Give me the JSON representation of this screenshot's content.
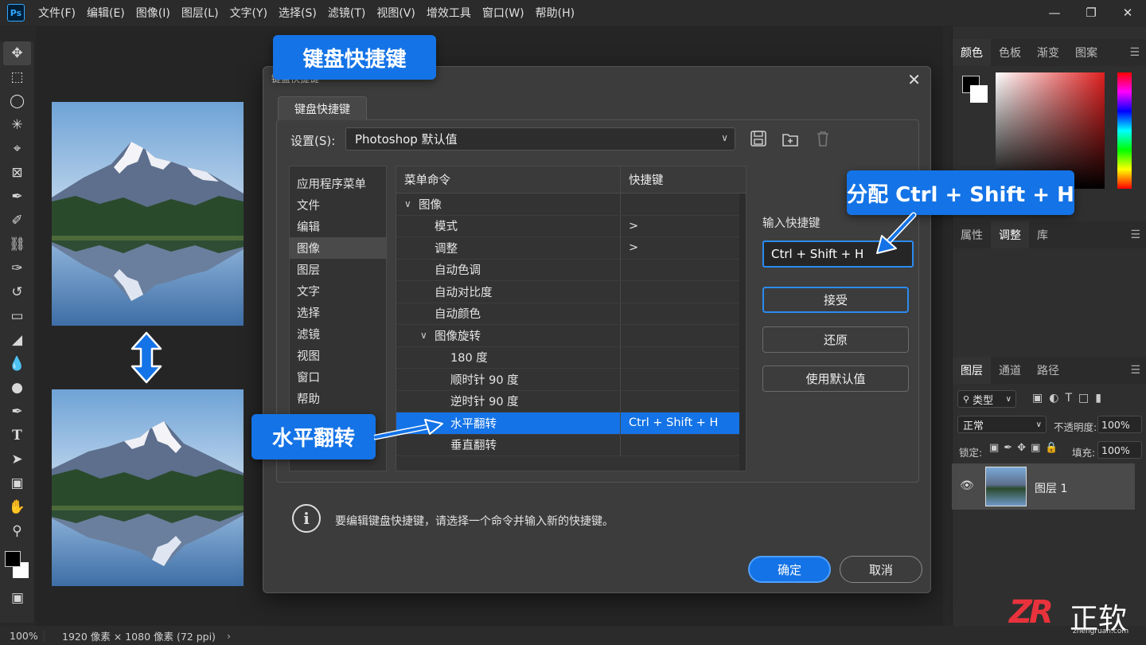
{
  "app": {
    "logo": "Ps"
  },
  "menu": [
    "文件(F)",
    "编辑(E)",
    "图像(I)",
    "图层(L)",
    "文字(Y)",
    "选择(S)",
    "滤镜(T)",
    "视图(V)",
    "增效工具",
    "窗口(W)",
    "帮助(H)"
  ],
  "status": {
    "zoom": "100%",
    "doc_info": "1920 像素 × 1080 像素 (72 ppi)"
  },
  "callouts": {
    "top": "键盘快捷键",
    "left": "水平翻转",
    "right": "分配 Ctrl + Shift + H"
  },
  "dialog": {
    "title": "键盘快捷键",
    "tab": "键盘快捷键",
    "set_label": "设置(S):",
    "set_value": "Photoshop 默认值",
    "categories": [
      "应用程序菜单",
      "文件",
      "编辑",
      "图像",
      "图层",
      "文字",
      "选择",
      "滤镜",
      "视图",
      "窗口",
      "帮助"
    ],
    "selected_category": "图像",
    "table": {
      "col_command": "菜单命令",
      "col_shortcut": "快捷键",
      "rows": [
        {
          "indent": 0,
          "twisty": "∨",
          "label": "图像",
          "shortcut": ""
        },
        {
          "indent": 1,
          "twisty": "",
          "label": "模式",
          "shortcut": ">"
        },
        {
          "indent": 1,
          "twisty": "",
          "label": "调整",
          "shortcut": ">"
        },
        {
          "indent": 1,
          "twisty": "",
          "label": "自动色调",
          "shortcut": ""
        },
        {
          "indent": 1,
          "twisty": "",
          "label": "自动对比度",
          "shortcut": ""
        },
        {
          "indent": 1,
          "twisty": "",
          "label": "自动颜色",
          "shortcut": ""
        },
        {
          "indent": 1,
          "twisty": "∨",
          "label": "图像旋转",
          "shortcut": ""
        },
        {
          "indent": 2,
          "twisty": "",
          "label": "180 度",
          "shortcut": ""
        },
        {
          "indent": 2,
          "twisty": "",
          "label": "顺时针 90 度",
          "shortcut": ""
        },
        {
          "indent": 2,
          "twisty": "",
          "label": "逆时针 90 度",
          "shortcut": ""
        },
        {
          "indent": 2,
          "twisty": "",
          "label": "水平翻转",
          "shortcut": "Ctrl + Shift + H",
          "selected": true
        },
        {
          "indent": 2,
          "twisty": "",
          "label": "垂直翻转",
          "shortcut": ""
        }
      ]
    },
    "input_label": "输入快捷键",
    "input_value": "Ctrl + Shift + H",
    "btn_accept": "接受",
    "btn_undo": "还原",
    "btn_default": "使用默认值",
    "info_text": "要编辑键盘快捷键，请选择一个命令并输入新的快捷键。",
    "btn_ok": "确定",
    "btn_cancel": "取消"
  },
  "panels": {
    "color_tabs": [
      "颜色",
      "色板",
      "渐变",
      "图案"
    ],
    "props_tabs": [
      "属性",
      "调整",
      "库"
    ],
    "layers_tabs": [
      "图层",
      "通道",
      "路径"
    ],
    "filter_kind": "类型",
    "blend_mode": "正常",
    "opacity_label": "不透明度:",
    "opacity_value": "100%",
    "lock_label": "锁定:",
    "fill_label": "填充:",
    "fill_value": "100%",
    "layer_name": "图层 1"
  },
  "watermark": {
    "brand": "ZR",
    "text": "正软",
    "url": "zhengruan.com"
  },
  "colors": {
    "accent": "#1473e6",
    "focus": "#2b8bf0"
  }
}
